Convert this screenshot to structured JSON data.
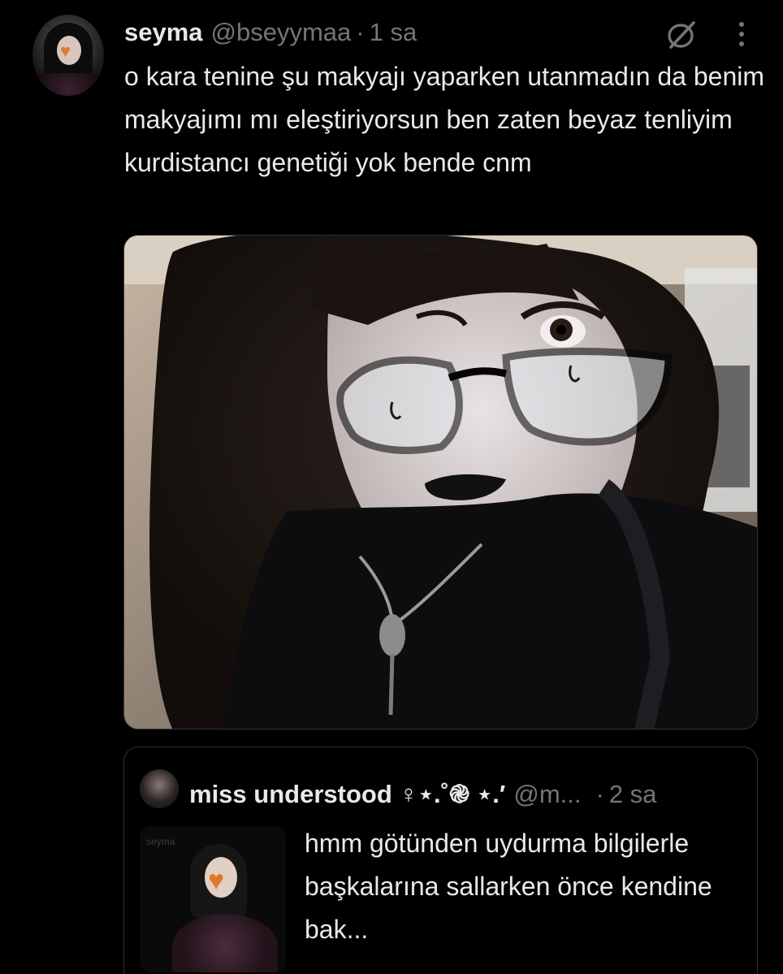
{
  "tweet": {
    "author_name": "seyma",
    "author_handle": "@bseyymaa",
    "separator": "·",
    "time": "1 sa",
    "text": "o kara tenine şu makyajı yaparken utanmadın da benim makyajımı mı eleştiriyorsun ben zaten beyaz tenliyim kurdistancı genetiği yok bende cnm"
  },
  "quote": {
    "author_name": "miss understood ♀︎⋆.˚֎ ⋆.′",
    "author_handle": "@m...",
    "separator": "·",
    "time": "2 sa",
    "text": "hmm götünden uydurma bilgilerle başkalarına sallarken önce kendine bak...",
    "thumb_bg_label": "seyma"
  },
  "icons": {
    "grok": "grok-icon",
    "more": "more-options-icon"
  },
  "colors": {
    "background": "#000000",
    "text_primary": "#e7e9ea",
    "text_secondary": "#71767b",
    "border": "#2f3336"
  }
}
